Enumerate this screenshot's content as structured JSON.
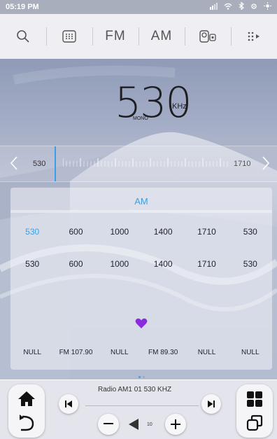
{
  "status": {
    "time": "05:19 PM"
  },
  "toolbar": {
    "fm_label": "FM",
    "am_label": "AM"
  },
  "radio": {
    "frequency": "530",
    "unit": "KHz",
    "mode": "MONO",
    "band": "AM"
  },
  "tuner": {
    "min_label": "530",
    "max_label": "1710"
  },
  "presets": {
    "row1": [
      "530",
      "600",
      "1000",
      "1400",
      "1710",
      "530"
    ],
    "row2": [
      "530",
      "600",
      "1000",
      "1400",
      "1710",
      "530"
    ],
    "active_index": 0
  },
  "stations": [
    "NULL",
    "FM 107.90",
    "NULL",
    "FM 89.30",
    "NULL",
    "NULL"
  ],
  "player": {
    "now_playing": "Radio  AM1  01   530 KHZ",
    "volume": "10"
  },
  "colors": {
    "accent": "#3b9fe8",
    "heart": "#8a2be2"
  }
}
